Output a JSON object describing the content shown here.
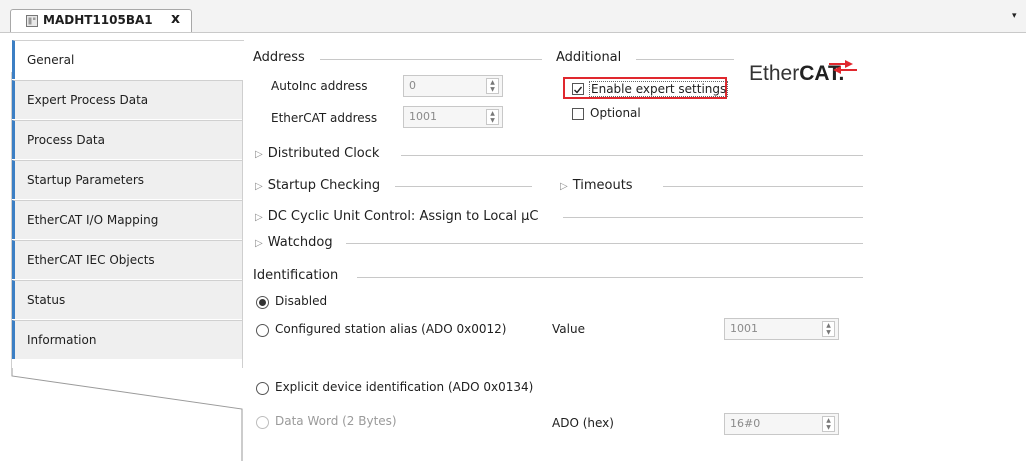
{
  "document_tab": {
    "title": "MADHT1105BA1",
    "close": "x"
  },
  "overflow_arrow": "▾",
  "side_tabs": [
    {
      "label": "General",
      "active": true
    },
    {
      "label": "Expert Process Data"
    },
    {
      "label": "Process Data"
    },
    {
      "label": "Startup Parameters"
    },
    {
      "label": "EtherCAT I/O Mapping"
    },
    {
      "label": "EtherCAT IEC Objects"
    },
    {
      "label": "Status"
    },
    {
      "label": "Information"
    }
  ],
  "address": {
    "heading": "Address",
    "autoinc_label": "AutoInc address",
    "autoinc_value": "0",
    "ethercat_label": "EtherCAT address",
    "ethercat_value": "1001"
  },
  "additional": {
    "heading": "Additional",
    "expert_label": "Enable expert settings",
    "expert_checked": true,
    "optional_label": "Optional",
    "optional_checked": false
  },
  "logo": {
    "text_light": "Ether",
    "text_bold": "CAT."
  },
  "collapsibles": {
    "distributed_clock": "Distributed Clock",
    "startup_checking": "Startup Checking",
    "timeouts": "Timeouts",
    "dc_cyclic": "DC Cyclic Unit Control: Assign to Local µC",
    "watchdog": "Watchdog"
  },
  "identification": {
    "heading": "Identification",
    "disabled_label": "Disabled",
    "configured_label": "Configured station alias (ADO 0x0012)",
    "value_label": "Value",
    "value_value": "1001",
    "explicit_label": "Explicit device identification (ADO 0x0134)",
    "dataword_label": "Data Word (2 Bytes)",
    "ado_label": "ADO (hex)",
    "ado_value": "16#0"
  },
  "colors": {
    "accent": "#3c7fc4",
    "highlight_border": "#e0282e",
    "logo_red": "#e0282e"
  }
}
